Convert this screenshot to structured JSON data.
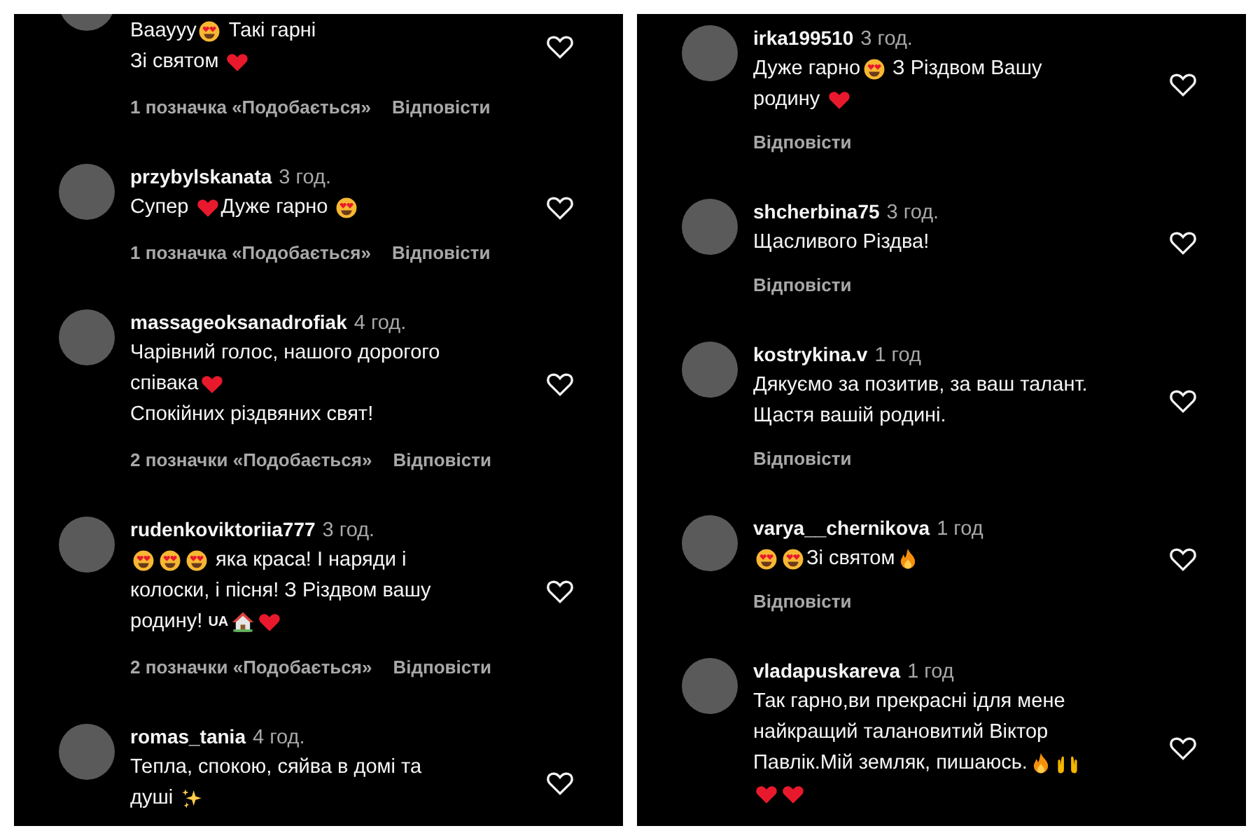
{
  "panels": [
    {
      "comments": [
        {
          "lines": [
            [
              {
                "kind": "text",
                "text": "Вааууу"
              },
              {
                "kind": "smiley"
              },
              {
                "kind": "text",
                "text": " Такі гарні"
              }
            ],
            [
              {
                "kind": "text",
                "text": "Зі святом "
              },
              {
                "kind": "heart"
              }
            ]
          ],
          "likes": "1 позначка «Подобається»",
          "reply": "Відповісти"
        },
        {
          "username": "przybylskanata",
          "time": "3 год.",
          "lines": [
            [
              {
                "kind": "text",
                "text": "Супер "
              },
              {
                "kind": "heart"
              },
              {
                "kind": "text",
                "text": "Дуже гарно "
              },
              {
                "kind": "smiley"
              }
            ]
          ],
          "likes": "1 позначка «Подобається»",
          "reply": "Відповісти"
        },
        {
          "username": "massageoksanadrofiak",
          "time": "4 год.",
          "lines": [
            [
              {
                "kind": "text",
                "text": "Чарівний голос, нашого дорогого"
              }
            ],
            [
              {
                "kind": "text",
                "text": "співака"
              },
              {
                "kind": "heart"
              }
            ],
            [
              {
                "kind": "text",
                "text": "Спокійних різдвяних свят!"
              }
            ]
          ],
          "likes": "2 позначки «Подобається»",
          "reply": "Відповісти"
        },
        {
          "username": "rudenkoviktoriia777",
          "time": "3 год.",
          "lines": [
            [
              {
                "kind": "smiley"
              },
              {
                "kind": "smiley"
              },
              {
                "kind": "smiley"
              },
              {
                "kind": "text",
                "text": " яка краса! І наряди і"
              }
            ],
            [
              {
                "kind": "text",
                "text": "колоски, і пісня! З Різдвом вашу"
              }
            ],
            [
              {
                "kind": "text",
                "text": "родину! "
              },
              {
                "kind": "flag",
                "text": "UA"
              },
              {
                "kind": "house"
              },
              {
                "kind": "heart"
              }
            ]
          ],
          "likes": "2 позначки «Подобається»",
          "reply": "Відповісти"
        },
        {
          "username": "romas_tania",
          "time": "4 год.",
          "lines": [
            [
              {
                "kind": "text",
                "text": "Тепла, спокою, сяйва в домі та"
              }
            ],
            [
              {
                "kind": "text",
                "text": "душі "
              },
              {
                "kind": "sparkles"
              }
            ]
          ]
        }
      ]
    },
    {
      "comments": [
        {
          "username": "irka199510",
          "time": "3 год.",
          "lines": [
            [
              {
                "kind": "text",
                "text": "Дуже гарно"
              },
              {
                "kind": "smiley"
              },
              {
                "kind": "text",
                "text": " З Різдвом Вашу"
              }
            ],
            [
              {
                "kind": "text",
                "text": "родину "
              },
              {
                "kind": "heart"
              }
            ]
          ],
          "reply": "Відповісти"
        },
        {
          "username": "shcherbina75",
          "time": "3 год.",
          "lines": [
            [
              {
                "kind": "text",
                "text": "Щасливого Різдва!"
              }
            ]
          ],
          "reply": "Відповісти"
        },
        {
          "username": "kostrykina.v",
          "time": "1 год",
          "lines": [
            [
              {
                "kind": "text",
                "text": "Дякуємо за позитив, за ваш талант."
              }
            ],
            [
              {
                "kind": "text",
                "text": "Щастя вашій родині."
              }
            ]
          ],
          "reply": "Відповісти"
        },
        {
          "username": "varya__chernikova",
          "time": "1 год",
          "lines": [
            [
              {
                "kind": "smiley"
              },
              {
                "kind": "smiley"
              },
              {
                "kind": "text",
                "text": "Зі святом"
              },
              {
                "kind": "fire"
              }
            ]
          ],
          "reply": "Відповісти"
        },
        {
          "username": "vladapuskareva",
          "time": "1 год",
          "lines": [
            [
              {
                "kind": "text",
                "text": "Так гарно,ви прекрасні ідля мене"
              }
            ],
            [
              {
                "kind": "text",
                "text": "найкращий талановитий Віктор"
              }
            ],
            [
              {
                "kind": "text",
                "text": "Павлік.Мій земляк, пишаюсь."
              },
              {
                "kind": "fire"
              },
              {
                "kind": "hands"
              }
            ],
            [
              {
                "kind": "heart"
              },
              {
                "kind": "heart"
              }
            ]
          ]
        }
      ]
    }
  ]
}
